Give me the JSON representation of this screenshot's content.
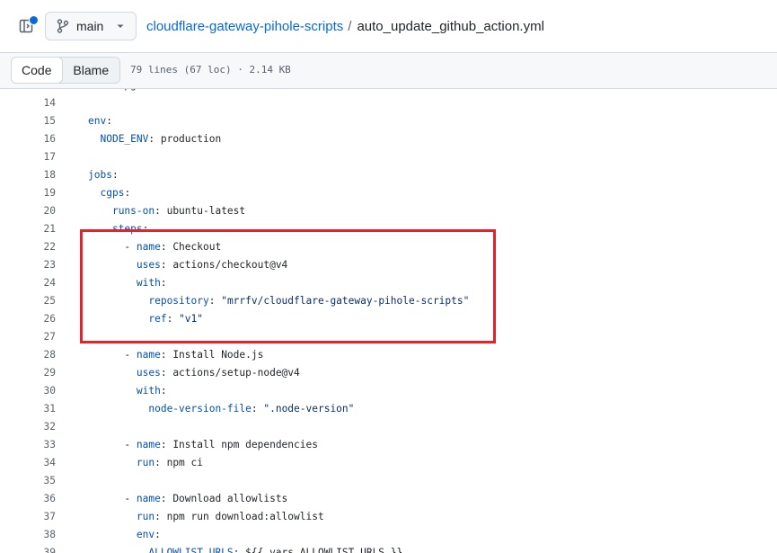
{
  "header": {
    "branch": "main",
    "repo": "cloudflare-gateway-pihole-scripts",
    "separator": "/",
    "file": "auto_update_github_action.yml"
  },
  "subbar": {
    "tabs": [
      {
        "label": "Code",
        "active": true
      },
      {
        "label": "Blame",
        "active": false
      }
    ],
    "file_info": "79 lines (67 loc) · 2.14 KB"
  },
  "code": {
    "partial_top_text": "      pg",
    "lines": [
      {
        "n": "14",
        "parts": []
      },
      {
        "n": "15",
        "parts": [
          {
            "t": "k",
            "v": "env"
          },
          {
            "t": "p",
            "v": ":"
          }
        ]
      },
      {
        "n": "16",
        "parts": [
          {
            "t": "p",
            "v": "  "
          },
          {
            "t": "k",
            "v": "NODE_ENV"
          },
          {
            "t": "p",
            "v": ": production"
          }
        ]
      },
      {
        "n": "17",
        "parts": []
      },
      {
        "n": "18",
        "parts": [
          {
            "t": "k",
            "v": "jobs"
          },
          {
            "t": "p",
            "v": ":"
          }
        ]
      },
      {
        "n": "19",
        "parts": [
          {
            "t": "p",
            "v": "  "
          },
          {
            "t": "k",
            "v": "cgps"
          },
          {
            "t": "p",
            "v": ":"
          }
        ]
      },
      {
        "n": "20",
        "parts": [
          {
            "t": "p",
            "v": "    "
          },
          {
            "t": "k",
            "v": "runs-on"
          },
          {
            "t": "p",
            "v": ": ubuntu-latest"
          }
        ]
      },
      {
        "n": "21",
        "parts": [
          {
            "t": "p",
            "v": "    "
          },
          {
            "t": "k",
            "v": "steps"
          },
          {
            "t": "p",
            "v": ":"
          }
        ]
      },
      {
        "n": "22",
        "parts": [
          {
            "t": "p",
            "v": "      - "
          },
          {
            "t": "k",
            "v": "name"
          },
          {
            "t": "p",
            "v": ": Checkout"
          }
        ]
      },
      {
        "n": "23",
        "parts": [
          {
            "t": "p",
            "v": "        "
          },
          {
            "t": "k",
            "v": "uses"
          },
          {
            "t": "p",
            "v": ": actions/checkout@v4"
          }
        ]
      },
      {
        "n": "24",
        "parts": [
          {
            "t": "p",
            "v": "        "
          },
          {
            "t": "k",
            "v": "with"
          },
          {
            "t": "p",
            "v": ":"
          }
        ]
      },
      {
        "n": "25",
        "parts": [
          {
            "t": "p",
            "v": "          "
          },
          {
            "t": "k",
            "v": "repository"
          },
          {
            "t": "p",
            "v": ": "
          },
          {
            "t": "s",
            "v": "\"mrrfv/cloudflare-gateway-pihole-scripts\""
          }
        ]
      },
      {
        "n": "26",
        "parts": [
          {
            "t": "p",
            "v": "          "
          },
          {
            "t": "k",
            "v": "ref"
          },
          {
            "t": "p",
            "v": ": "
          },
          {
            "t": "s",
            "v": "\"v1\""
          }
        ]
      },
      {
        "n": "27",
        "parts": []
      },
      {
        "n": "28",
        "parts": [
          {
            "t": "p",
            "v": "      - "
          },
          {
            "t": "k",
            "v": "name"
          },
          {
            "t": "p",
            "v": ": Install Node.js"
          }
        ]
      },
      {
        "n": "29",
        "parts": [
          {
            "t": "p",
            "v": "        "
          },
          {
            "t": "k",
            "v": "uses"
          },
          {
            "t": "p",
            "v": ": actions/setup-node@v4"
          }
        ]
      },
      {
        "n": "30",
        "parts": [
          {
            "t": "p",
            "v": "        "
          },
          {
            "t": "k",
            "v": "with"
          },
          {
            "t": "p",
            "v": ":"
          }
        ]
      },
      {
        "n": "31",
        "parts": [
          {
            "t": "p",
            "v": "          "
          },
          {
            "t": "k",
            "v": "node-version-file"
          },
          {
            "t": "p",
            "v": ": "
          },
          {
            "t": "s",
            "v": "\".node-version\""
          }
        ]
      },
      {
        "n": "32",
        "parts": []
      },
      {
        "n": "33",
        "parts": [
          {
            "t": "p",
            "v": "      - "
          },
          {
            "t": "k",
            "v": "name"
          },
          {
            "t": "p",
            "v": ": Install npm dependencies"
          }
        ]
      },
      {
        "n": "34",
        "parts": [
          {
            "t": "p",
            "v": "        "
          },
          {
            "t": "k",
            "v": "run"
          },
          {
            "t": "p",
            "v": ": npm ci"
          }
        ]
      },
      {
        "n": "35",
        "parts": []
      },
      {
        "n": "36",
        "parts": [
          {
            "t": "p",
            "v": "      - "
          },
          {
            "t": "k",
            "v": "name"
          },
          {
            "t": "p",
            "v": ": Download allowlists"
          }
        ]
      },
      {
        "n": "37",
        "parts": [
          {
            "t": "p",
            "v": "        "
          },
          {
            "t": "k",
            "v": "run"
          },
          {
            "t": "p",
            "v": ": npm run download:allowlist"
          }
        ]
      },
      {
        "n": "38",
        "parts": [
          {
            "t": "p",
            "v": "        "
          },
          {
            "t": "k",
            "v": "env"
          },
          {
            "t": "p",
            "v": ":"
          }
        ]
      },
      {
        "n": "39",
        "parts": [
          {
            "t": "p",
            "v": "          "
          },
          {
            "t": "k",
            "v": "ALLOWLIST_URLS"
          },
          {
            "t": "p",
            "v": ": ${{ vars.ALLOWLIST_URLS }}"
          }
        ]
      }
    ]
  },
  "colors": {
    "link": "#0969da",
    "annotation": "#e3222b",
    "yaml_key": "#0550ae",
    "yaml_string": "#0a3069"
  },
  "icons": [
    "side-panel-icon",
    "git-branch-icon",
    "caret-down-icon"
  ]
}
